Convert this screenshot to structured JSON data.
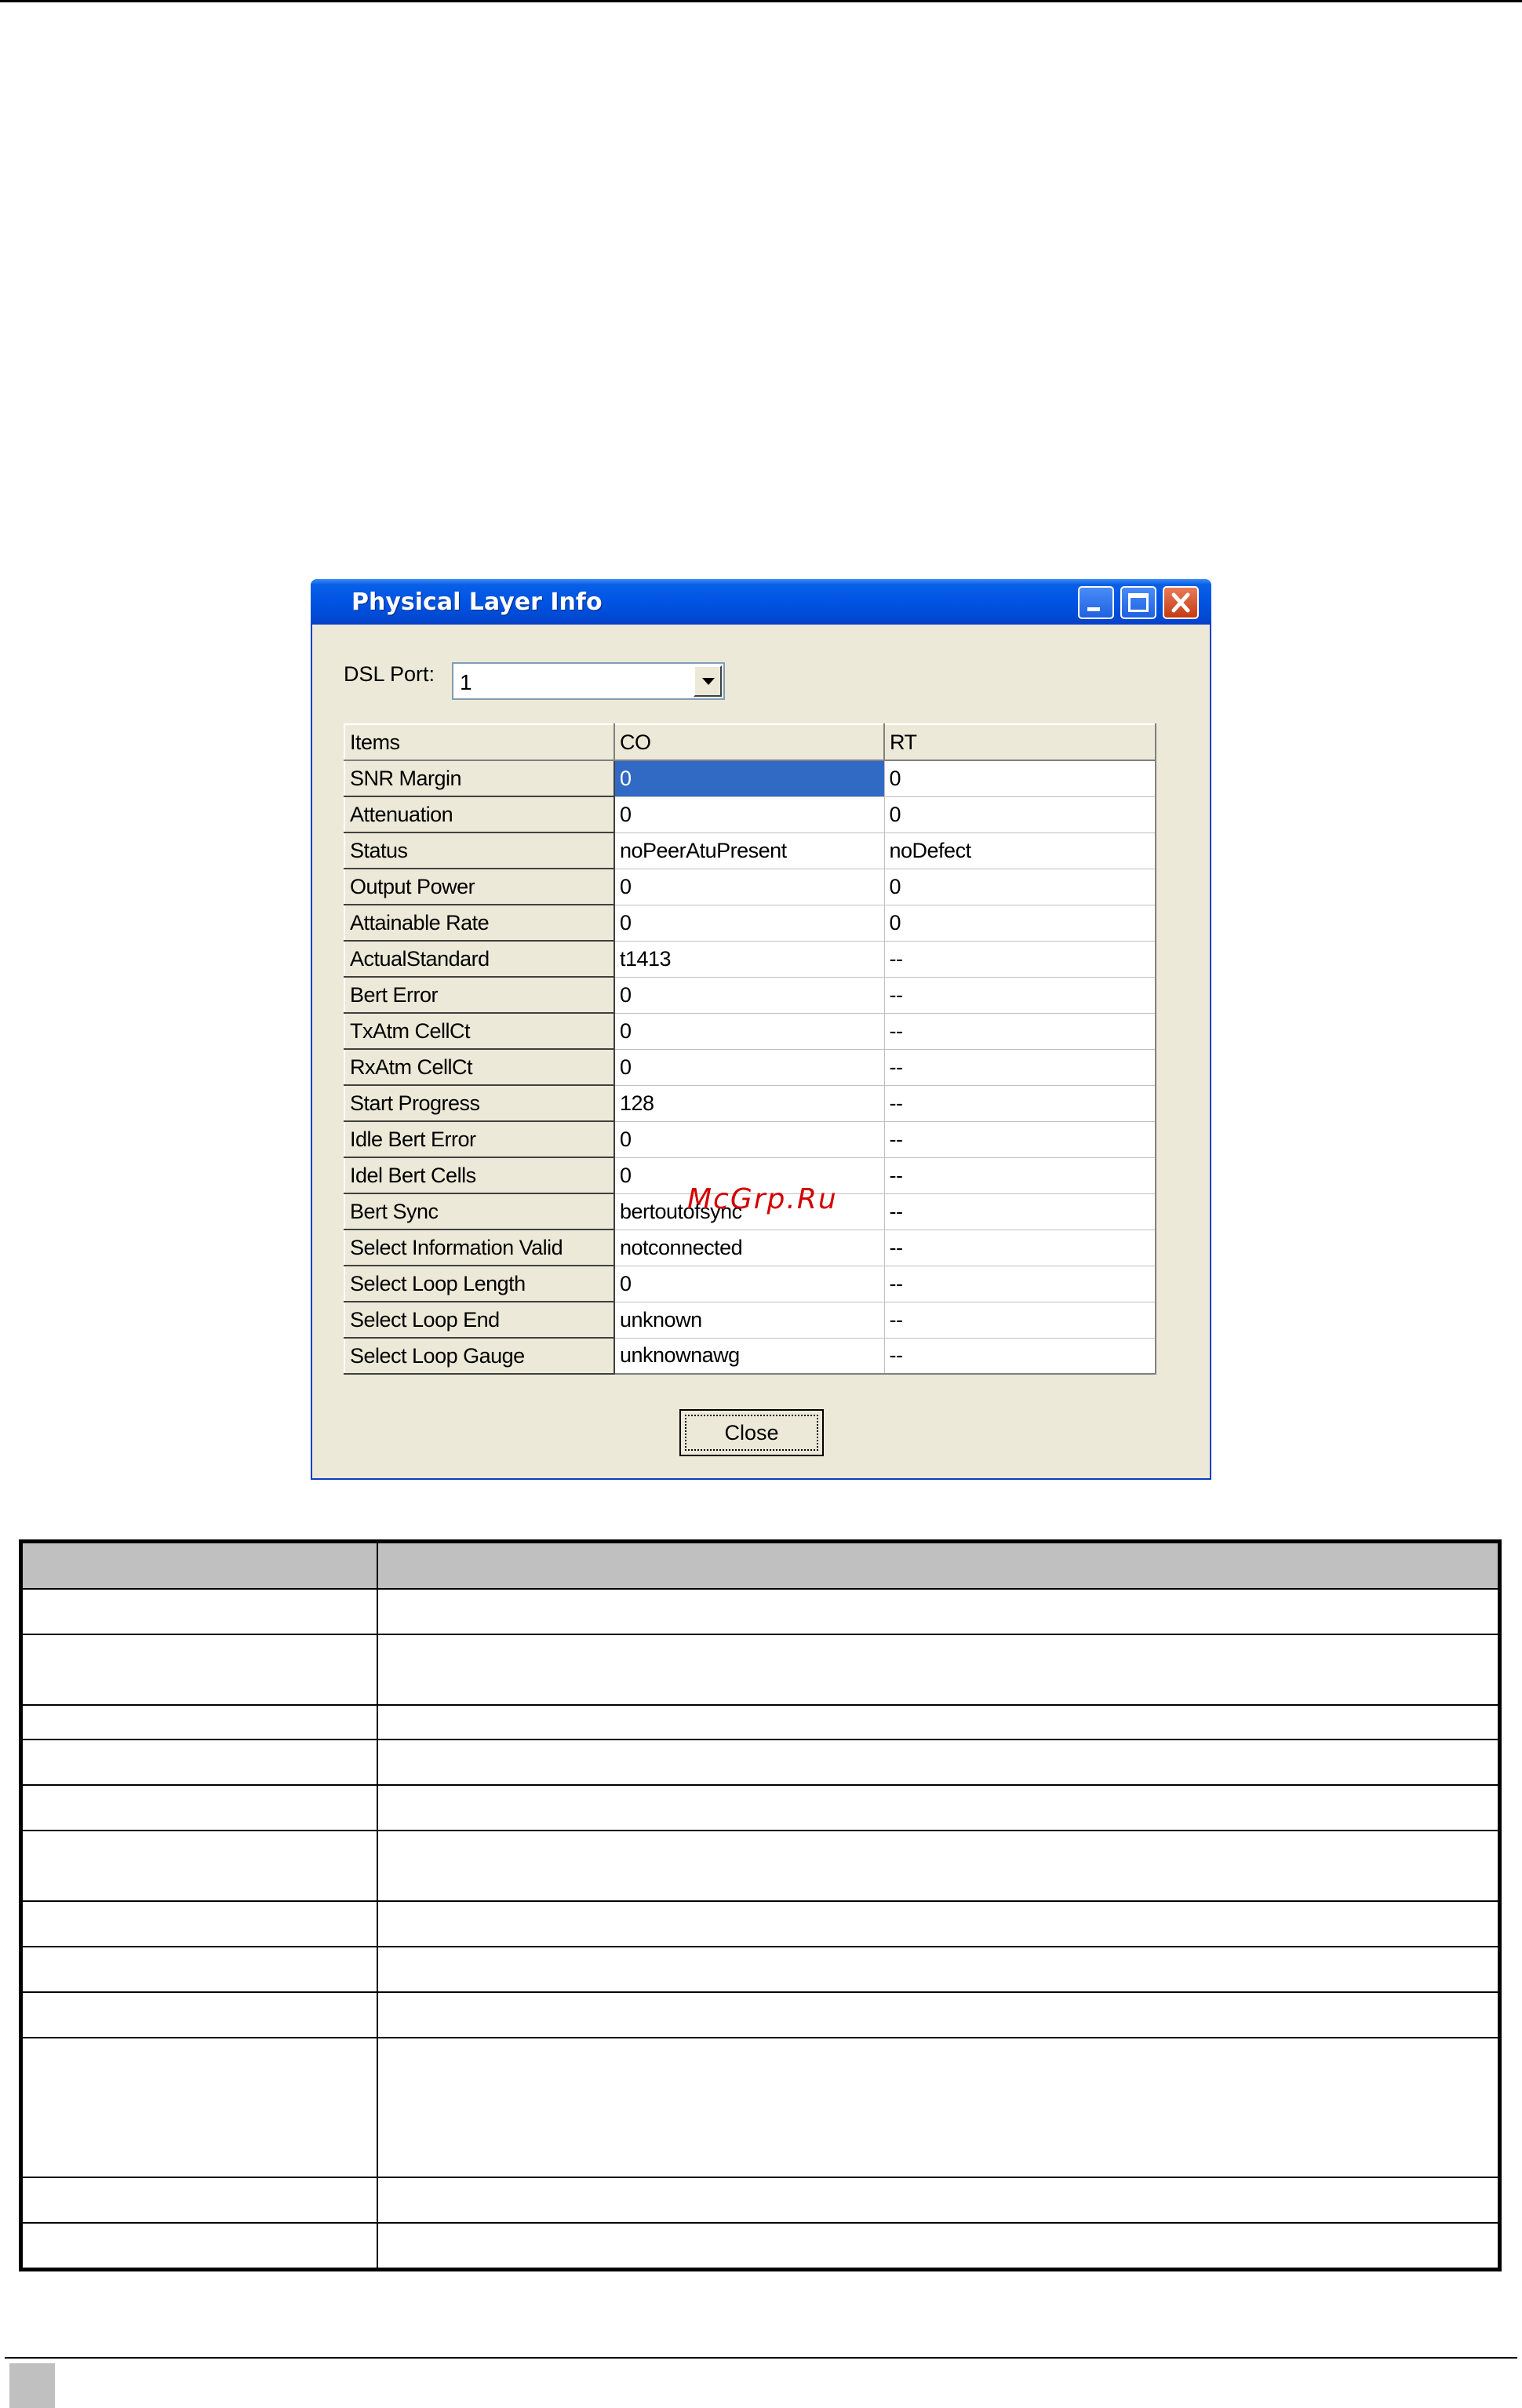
{
  "window": {
    "title": "Physical Layer Info",
    "dsl_port_label": "DSL Port:",
    "dsl_port_value": "1",
    "close_label": "Close"
  },
  "grid": {
    "headers": [
      "Items",
      "CO",
      "RT"
    ],
    "rows": [
      {
        "item": "SNR Margin",
        "co": "0",
        "rt": "0"
      },
      {
        "item": "Attenuation",
        "co": "0",
        "rt": "0"
      },
      {
        "item": "Status",
        "co": "noPeerAtuPresent",
        "rt": "noDefect"
      },
      {
        "item": "Output Power",
        "co": "0",
        "rt": "0"
      },
      {
        "item": "Attainable Rate",
        "co": "0",
        "rt": "0"
      },
      {
        "item": "ActualStandard",
        "co": "t1413",
        "rt": "--"
      },
      {
        "item": "Bert Error",
        "co": "0",
        "rt": "--"
      },
      {
        "item": "TxAtm CellCt",
        "co": "0",
        "rt": "--"
      },
      {
        "item": "RxAtm CellCt",
        "co": "0",
        "rt": "--"
      },
      {
        "item": "Start Progress",
        "co": "128",
        "rt": "--"
      },
      {
        "item": "Idle Bert Error",
        "co": "0",
        "rt": "--"
      },
      {
        "item": "Idel Bert Cells",
        "co": "0",
        "rt": "--"
      },
      {
        "item": "Bert Sync",
        "co": "bertoutofsync",
        "rt": "--"
      },
      {
        "item": "Select Information Valid",
        "co": "notconnected",
        "rt": "--"
      },
      {
        "item": "Select Loop Length",
        "co": "0",
        "rt": "--"
      },
      {
        "item": "Select Loop End",
        "co": "unknown",
        "rt": "--"
      },
      {
        "item": "Select Loop Gauge",
        "co": "unknownawg",
        "rt": "--"
      }
    ]
  },
  "watermark": "McGrp.Ru",
  "colors": {
    "titlebar": "#0054e3",
    "selection": "#316ac5",
    "dialog_bg": "#ece9d8",
    "watermark": "#d40000"
  }
}
